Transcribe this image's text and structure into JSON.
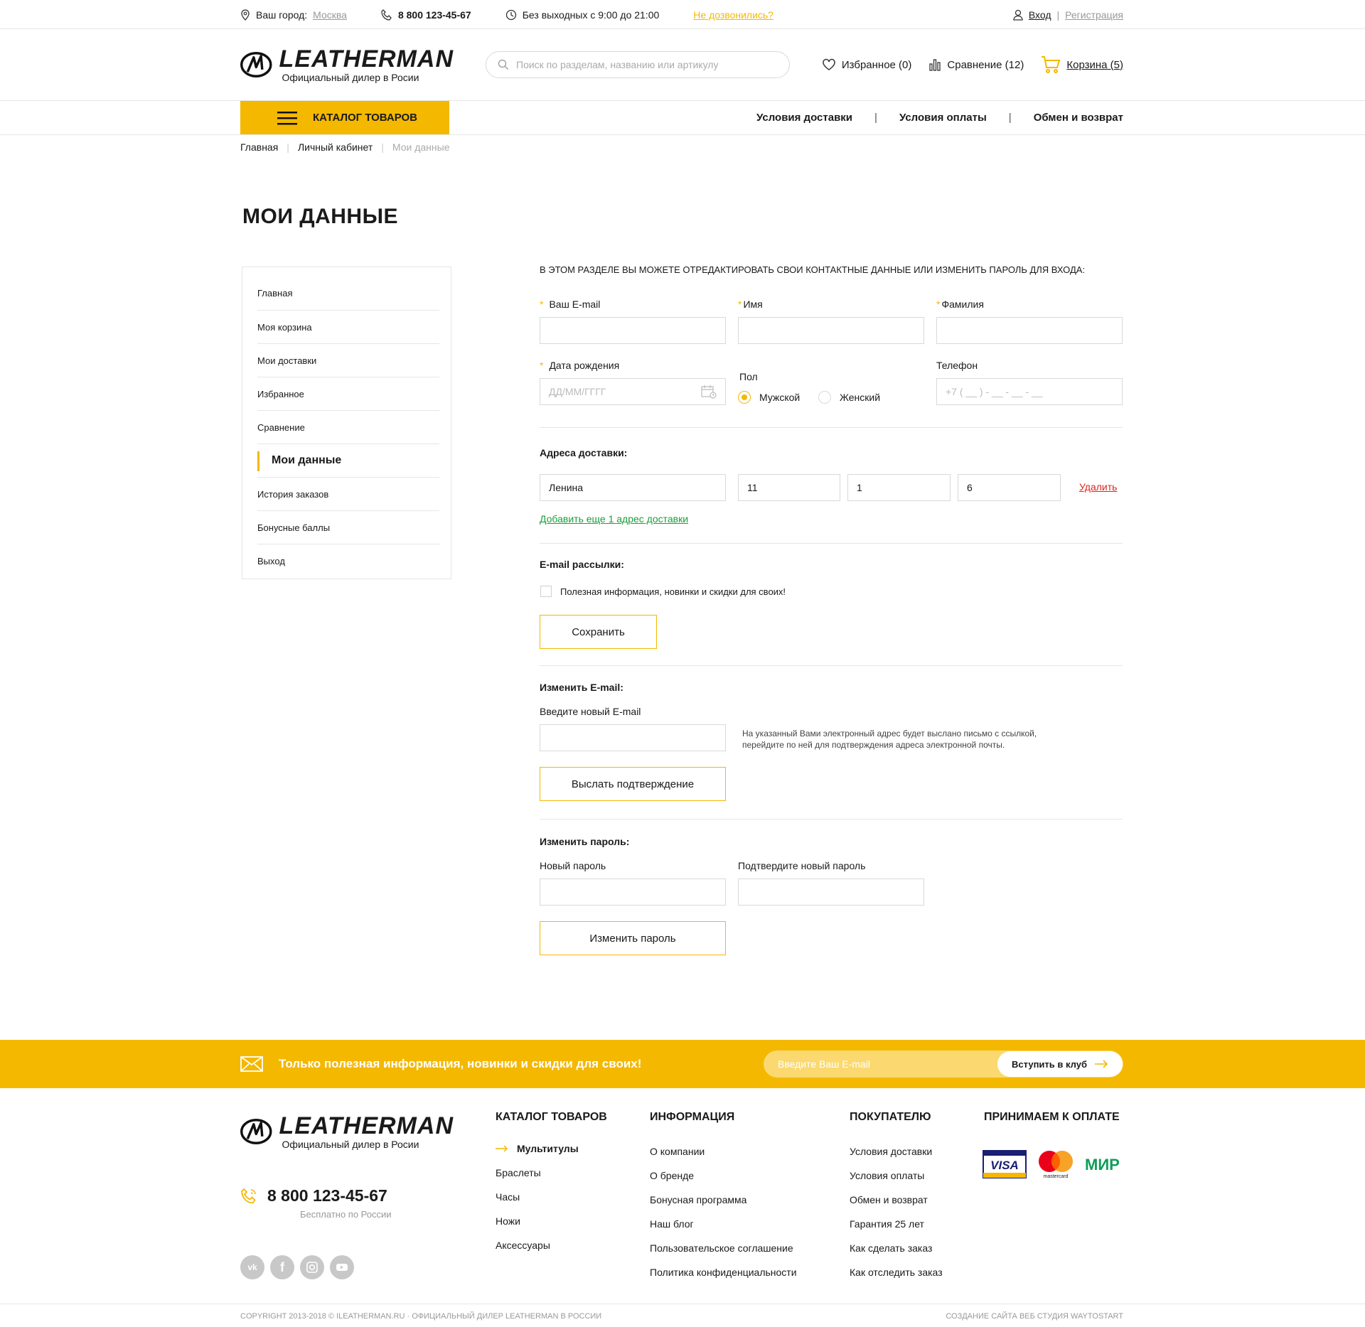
{
  "topbar": {
    "city_label": "Ваш город:",
    "city_value": "Москва",
    "phone": "8 800 123-45-67",
    "hours": "Без выходных с 9:00 до 21:00",
    "callback": "Не дозвонились?",
    "login": "Вход",
    "separator": "|",
    "register": "Регистрация"
  },
  "header": {
    "logo_word": "LEATHERMAN",
    "logo_sub": "Официальный дилер в Росии",
    "search_placeholder": "Поиск по разделам, названию или артикулу",
    "favorites": "Избранное (0)",
    "compare": "Сравнение (12)",
    "cart": "Корзина (5)"
  },
  "nav": {
    "catalog": "КАТАЛОГ ТОВАРОВ",
    "links": [
      "Условия доставки",
      "Условия оплаты",
      "Обмен и возврат"
    ],
    "separator": "|"
  },
  "breadcrumb": {
    "items": [
      "Главная",
      "Личный кабинет",
      "Мои данные"
    ],
    "separator": "|"
  },
  "page_title": "МОИ ДАННЫЕ",
  "sidebar": {
    "items": [
      "Главная",
      "Моя корзина",
      "Мои доставки",
      "Избранное",
      "Сравнение",
      "Мои данные",
      "История заказов",
      "Бонусные баллы",
      "Выход"
    ],
    "active_index": 5
  },
  "form": {
    "intro": "В этом разделе вы можете отредактировать свои контактные данные или изменить пароль для входа:",
    "required_mark": "*",
    "email_label": "Ваш E-mail",
    "name_label": "Имя",
    "surname_label": "Фамилия",
    "birth_label": "Дата рождения",
    "birth_placeholder": "ДД/ММ/ГГГГ",
    "gender_label": "Пол",
    "gender_male": "Мужской",
    "gender_female": "Женский",
    "gender_selected": "Мужской",
    "phone_label": "Телефон",
    "phone_placeholder": "+7 ( __ ) - __ - __ - __",
    "address_title": "Адреса доставки:",
    "address": {
      "street": "Ленина",
      "house": "11",
      "building": "1",
      "apartment": "6"
    },
    "delete": "Удалить",
    "add_address": "Добавить еще 1 адрес доставки",
    "newsletter_title": "E-mail рассылки:",
    "newsletter_checkbox": "Полезная информация, новинки и скидки для своих!",
    "newsletter_checked": false,
    "save": "Сохранить",
    "change_email_title": "Изменить E-mail:",
    "new_email_label": "Введите новый E-mail",
    "new_email_hint": "На указанный Вами электронный адрес будет выслано письмо с ссылкой, перейдите по ней для подтверждения адреса электронной почты.",
    "send_confirm": "Выслать подтверждение",
    "change_password_title": "Изменить пароль:",
    "new_password_label": "Новый пароль",
    "confirm_password_label": "Подтвердите новый пароль",
    "change_password": "Изменить пароль"
  },
  "band": {
    "text": "Только полезная информация, новинки и скидки для своих!",
    "placeholder": "Введите Ваш E-mail",
    "button": "Вступить в клуб"
  },
  "footer": {
    "logo_word": "LEATHERMAN",
    "logo_sub": "Официальный дилер в Росии",
    "phone": "8 800 123-45-67",
    "phone_sub": "Бесплатно по России",
    "socials": [
      "vk-icon",
      "facebook-icon",
      "instagram-icon",
      "youtube-icon"
    ],
    "catalog_title": "КАТАЛОГ ТОВАРОВ",
    "catalog_links": [
      "Мультитулы",
      "Браслеты",
      "Часы",
      "Ножи",
      "Аксессуары"
    ],
    "info_title": "ИНФОРМАЦИЯ",
    "info_links": [
      "О компании",
      "О бренде",
      "Бонусная программа",
      "Наш блог",
      "Пользовательское соглашение",
      "Политика конфиденциальности"
    ],
    "buyer_title": "ПОКУПАТЕЛЮ",
    "buyer_links": [
      "Условия доставки",
      "Условия оплаты",
      "Обмен и возврат",
      "Гарантия 25 лет",
      "Как сделать заказ",
      "Как отследить заказ"
    ],
    "pay_title": "ПРИНИМАЕМ К ОПЛАТЕ",
    "pay_visa": "VISA",
    "pay_mastercard": "mastercard",
    "pay_mir": "МИР",
    "copyright": "Copyright 2013-2018 © ileatherman.ru · Официальный дилер Leatherman в России",
    "studio": "Создание сайта веб студия WAYTOSTART"
  },
  "colors": {
    "accent": "#f4b800",
    "link_green": "#1a9e3a",
    "link_red": "#e0241b",
    "border": "#e6e6e6"
  }
}
